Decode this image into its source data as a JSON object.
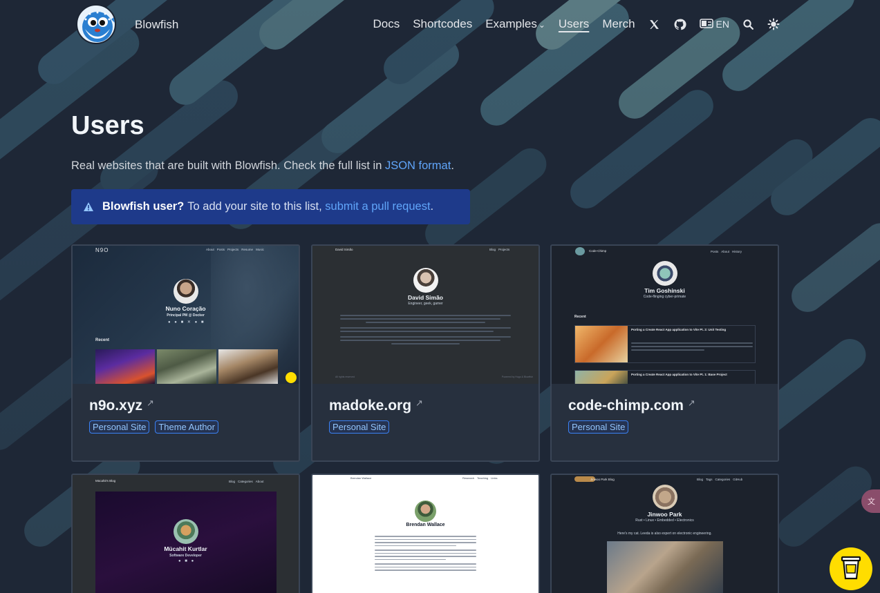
{
  "header": {
    "site_title": "Blowfish",
    "nav": {
      "docs": "Docs",
      "shortcodes": "Shortcodes",
      "examples": "Examples",
      "users": "Users",
      "merch": "Merch",
      "language": "EN"
    },
    "icons": [
      "x-twitter-icon",
      "github-icon",
      "language-icon",
      "search-icon",
      "theme-toggle-icon"
    ]
  },
  "page": {
    "title": "Users",
    "lead_text": "Real websites that are built with Blowfish. Check the full list in ",
    "lead_link": "JSON format",
    "lead_end": ".",
    "admonition": {
      "bold": "Blowfish user?",
      "text": " To add your site to this list, ",
      "link": "submit a pull request",
      "end": "."
    }
  },
  "cards": [
    {
      "name": "n9o.xyz",
      "tags": [
        "Personal Site",
        "Theme Author"
      ],
      "preview": {
        "brand": "N9O",
        "nav": [
          "About",
          "Posts",
          "Projects",
          "Resume",
          "Music"
        ],
        "person": "Nuno Coração",
        "role": "Principal PM @ Docker",
        "section": "Recent"
      }
    },
    {
      "name": "madoke.org",
      "tags": [
        "Personal Site"
      ],
      "preview": {
        "brand": "David Simão",
        "nav": [
          "Blog",
          "Projects"
        ],
        "person": "David Simão",
        "role": "Engineer, geek, gamer",
        "footer_left": "All rights reserved",
        "footer_right": "Powered by Hugo & Blowfish"
      }
    },
    {
      "name": "code-chimp.com",
      "tags": [
        "Personal Site"
      ],
      "preview": {
        "brand": "Code-Chimp",
        "nav": [
          "Posts",
          "About",
          "History"
        ],
        "person": "Tim Goshinski",
        "role": "Code-flinging cyber-primate",
        "section": "Recent",
        "post1": "Porting a Create React App application to Vite Pt. 2: Unit Testing",
        "post2": "Porting a Create React App application to Vite Pt. 1: Base Project"
      }
    },
    {
      "preview": {
        "brand": "Mücahit's Blog",
        "nav": [
          "Blog",
          "Categories",
          "About"
        ],
        "person": "Mücahit Kurtlar",
        "role": "Software Developer"
      }
    },
    {
      "preview": {
        "brand": "Brendan Wallace",
        "nav": [
          "Research",
          "Teaching",
          "Links"
        ],
        "person": "Brendan Wallace"
      }
    },
    {
      "preview": {
        "brand": "Jinwoo Park Blog",
        "nav": [
          "Blog",
          "Tags",
          "Categories",
          "GitHub"
        ],
        "person": "Jinwoo Park",
        "role": "Rust • Linux • Embedded • Electronics",
        "caption": "Here's my cat. Leeda is also expert on electronic engineering."
      }
    }
  ],
  "colors": {
    "background": "#1e2736",
    "accent": "#60a5fa",
    "admonition_bg": "#1e3a8a",
    "card_bg": "#27303e"
  }
}
